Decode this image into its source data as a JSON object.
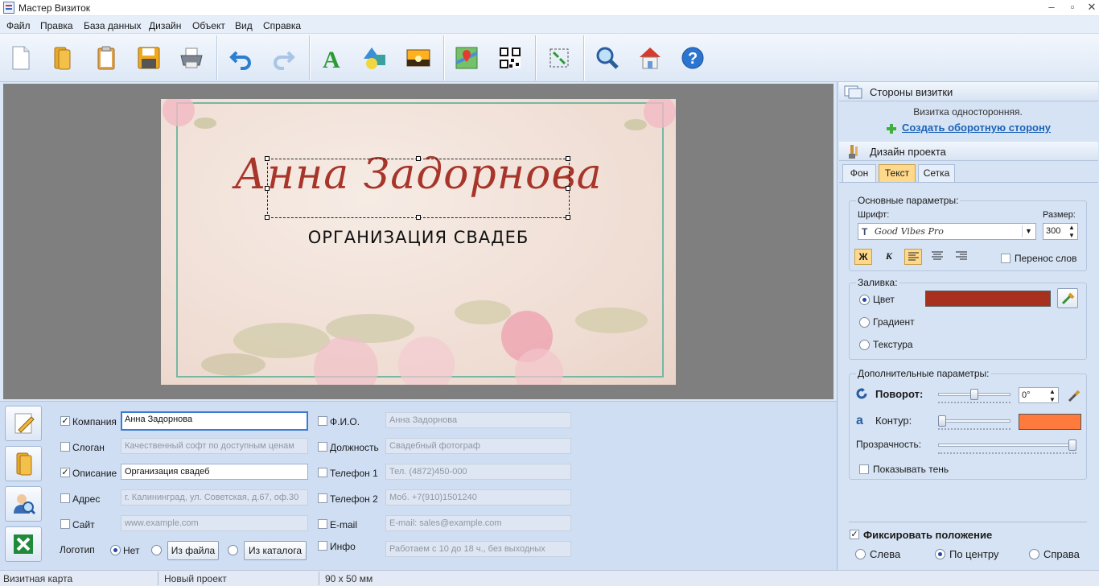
{
  "window": {
    "title": "Мастер Визиток"
  },
  "menu": [
    "Файл",
    "Правка",
    "База данных",
    "Дизайн",
    "Объект",
    "Вид",
    "Справка"
  ],
  "toolbar": {
    "icons": [
      "new-file-icon",
      "open-folder-icon",
      "clipboard-icon",
      "save-icon",
      "print-icon",
      "undo-icon",
      "redo-icon",
      "text-icon",
      "shapes-icon",
      "image-icon",
      "map-icon",
      "qr-code-icon",
      "fit-size-icon",
      "zoom-icon",
      "home-icon",
      "help-icon"
    ]
  },
  "card": {
    "name": "Анна Задорнова",
    "description": "ОРГАНИЗАЦИЯ СВАДЕБ",
    "name_color": "#a8352a",
    "border_color": "#76b8a4"
  },
  "fields_left": [
    {
      "label": "Компания",
      "checked": true,
      "value": "Анна Задорнова"
    },
    {
      "label": "Слоган",
      "checked": false,
      "value": "Качественный софт по доступным ценам"
    },
    {
      "label": "Описание",
      "checked": true,
      "value": "Организация свадеб"
    },
    {
      "label": "Адрес",
      "checked": false,
      "value": "г. Калининград, ул. Советская, д.67, оф.30"
    },
    {
      "label": "Сайт",
      "checked": false,
      "value": "www.example.com"
    }
  ],
  "fields_right": [
    {
      "label": "Ф.И.О.",
      "checked": false,
      "value": "Анна Задорнова"
    },
    {
      "label": "Должность",
      "checked": false,
      "value": "Свадебный фотограф"
    },
    {
      "label": "Телефон 1",
      "checked": false,
      "value": "Тел. (4872)450-000"
    },
    {
      "label": "Телефон 2",
      "checked": false,
      "value": "Моб. +7(910)1501240"
    },
    {
      "label": "E-mail",
      "checked": false,
      "value": "E-mail: sales@example.com"
    },
    {
      "label": "Инфо",
      "checked": false,
      "value": "Работаем с 10 до 18 ч., без выходных"
    }
  ],
  "logo": {
    "label": "Логотип",
    "option_none": "Нет",
    "from_file": "Из файла",
    "from_catalog": "Из каталога",
    "selected": "Нет"
  },
  "status": {
    "type": "Визитная карта",
    "project": "Новый проект",
    "size": "90 x 50 мм"
  },
  "sides_panel": {
    "title": "Стороны визитки",
    "info": "Визитка односторонняя.",
    "link": "Создать оборотную сторону"
  },
  "design_panel": {
    "title": "Дизайн проекта",
    "tabs": [
      "Фон",
      "Текст",
      "Сетка"
    ],
    "selected_tab": "Текст",
    "basic": {
      "title": "Основные параметры:",
      "font_label": "Шрифт:",
      "font": "Good Vibes Pro",
      "size_label": "Размер:",
      "size": "300",
      "bold": "Ж",
      "italic": "К",
      "wrap": "Перенос слов"
    },
    "fill": {
      "title": "Заливка:",
      "options": [
        "Цвет",
        "Градиент",
        "Текстура"
      ],
      "selected": "Цвет",
      "color": "#a8301f"
    },
    "extra": {
      "title": "Дополнительные параметры:",
      "rotation_label": "Поворот:",
      "rotation": "0°",
      "rotation_level": 0.5,
      "outline_label": "Контур:",
      "outline_color": "#ff7a3d",
      "outline_level": 0.0,
      "opacity_label": "Прозрачность:",
      "opacity_level": 1.0,
      "shadow": "Показывать тень"
    },
    "fix_position": "Фиксировать положение",
    "align": [
      "Слева",
      "По центру",
      "Справа"
    ],
    "align_selected": "По центру"
  }
}
